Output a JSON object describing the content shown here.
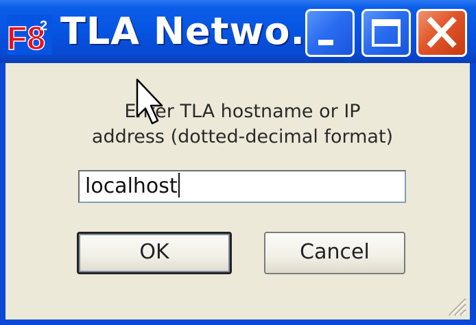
{
  "window": {
    "app_icon_text": "F8²",
    "title": "TLA Netwo...",
    "controls": {
      "minimize": "minimize-icon",
      "maximize": "maximize-icon",
      "close": "close-icon"
    }
  },
  "dialog": {
    "prompt_line1": "Enter TLA hostname or IP",
    "prompt_line2": "address (dotted-decimal format)",
    "host_input": {
      "value": "localhost"
    },
    "ok_label": "OK",
    "cancel_label": "Cancel"
  },
  "colors": {
    "titlebar": "#0654e2",
    "client_bg": "#ece9d8",
    "close_button": "#e0552a",
    "app_icon": "#e8101a"
  }
}
